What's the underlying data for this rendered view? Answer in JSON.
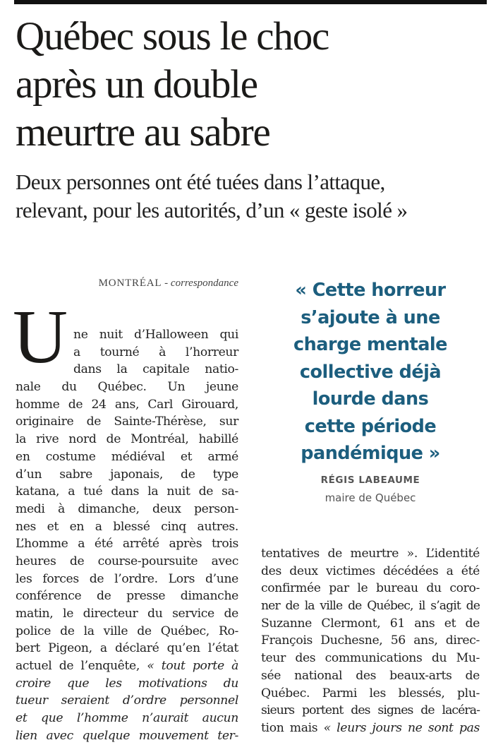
{
  "article": {
    "headline_lines": [
      "Québec sous le choc",
      "après un double",
      "meurtre au sabre"
    ],
    "dek_lines": [
      "Deux personnes ont été tuées dans l’attaque,",
      "relevant, pour les autorités, d’un « geste isolé »"
    ],
    "byline": {
      "place": "MONTRÉAL",
      "separator": " - ",
      "type": "correspondance"
    },
    "drop_cap": "U",
    "left_column": [
      "ne nuit d’Halloween qui",
      "a tourné à l’horreur",
      "dans la capitale natio-",
      "nale du Québec. Un jeune",
      "homme de 24 ans, Carl Girouard,",
      "originaire de Sainte-Thérèse, sur",
      "la rive nord de Montréal, habillé",
      "en costume médiéval et armé",
      "d’un sabre japonais, de type",
      "katana, a tué dans la nuit de sa-",
      "medi à dimanche, deux person-",
      "nes et en a blessé cinq autres.",
      "L’homme a été arrêté après trois",
      "heures de course-poursuite avec",
      "les forces de l’ordre. Lors d’une",
      "conférence de presse dimanche",
      "matin, le directeur du service de",
      "police de la ville de Québec, Ro-",
      "bert Pigeon, a déclaré qu’en l’état",
      "actuel de l’enquête,",
      "« tout porte à",
      "croire que les motivations du",
      "tueur seraient d’ordre personnel",
      "et que l’homme n’aurait aucun",
      "lien avec quelque mouvement ter-"
    ],
    "right_column": [
      "tentatives de meurtre ». L’identité",
      "des deux victimes décédées a été",
      "confirmée par le bureau du coro-",
      "ner de la ville de Québec, il s’agit de",
      "Suzanne Clermont, 61 ans et de",
      "François Duchesne, 56 ans, direc-",
      "teur des communications du Mu-",
      "sée national des beaux-arts de",
      "Québec. Parmi les blessés, plu-",
      "sieurs portent des signes de lacéra-",
      "tion mais",
      "« leurs jours ne sont pas"
    ]
  },
  "pull_quote": {
    "lines": [
      "« Cette horreur",
      "s’ajoute à une",
      "charge mentale",
      "collective déjà",
      "lourde dans",
      "cette période",
      "pandémique »"
    ],
    "author": "RÉGIS LABEAUME",
    "role": "maire de Québec",
    "color": "#1c5e7e"
  }
}
